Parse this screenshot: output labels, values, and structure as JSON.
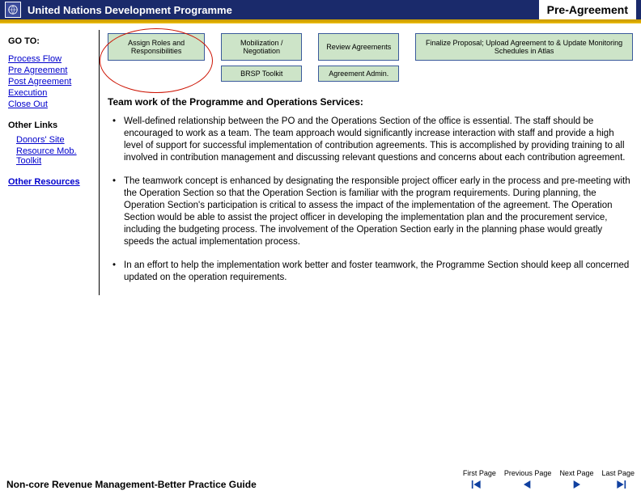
{
  "header": {
    "org": "United Nations Development Programme",
    "page_label": "Pre-Agreement"
  },
  "sidebar": {
    "goto": "GO TO:",
    "links": {
      "process_flow": "Process Flow",
      "pre_agreement": "Pre Agreement",
      "post_agreement": "Post Agreement",
      "execution": "Execution",
      "close_out": "Close Out"
    },
    "other_links_label": "Other Links",
    "other_links": {
      "donors_site": "Donors' Site",
      "resource_mob": "Resource Mob. Toolkit"
    },
    "other_resources_label": "Other Resources"
  },
  "flow": {
    "col1": {
      "top": "Assign Roles and Responsibilities"
    },
    "col2": {
      "top": "Mobilization / Negotiation",
      "bot": "BRSP Toolkit"
    },
    "col3": {
      "top": "Review Agreements",
      "bot": "Agreement Admin."
    },
    "col4": {
      "top": "Finalize Proposal; Upload Agreement to & Update Monitoring Schedules in Atlas"
    }
  },
  "main": {
    "heading": "Team work of the Programme and Operations Services:",
    "bullet1": "Well-defined relationship between the PO and the Operations Section of the office is essential.  The staff should be encouraged to work as a team. The  team approach would significantly increase interaction with staff and provide a high level of support for successful implementation of contribution agreements. This is accomplished by providing training to all involved in contribution management and discussing relevant questions and concerns about each contribution agreement.",
    "bullet2": "The teamwork concept is enhanced by designating the responsible project officer early in the process and pre-meeting with the Operation Section so that the Operation Section is familiar with the program requirements. During planning, the Operation Section's participation is critical to assess the impact of the implementation of the agreement. The Operation Section would be able to assist the project officer in developing the implementation plan and the procurement service, including the budgeting process. The involvement of the Operation Section early in the planning phase would greatly speeds the actual implementation process.",
    "bullet3": "In an effort to help the implementation work better and foster teamwork, the Programme Section should keep all concerned updated on the operation requirements."
  },
  "footer": {
    "title": "Non-core Revenue Management-Better Practice Guide",
    "nav": {
      "first": "First Page",
      "previous": "Previous Page",
      "next": "Next Page",
      "last": "Last Page"
    }
  }
}
